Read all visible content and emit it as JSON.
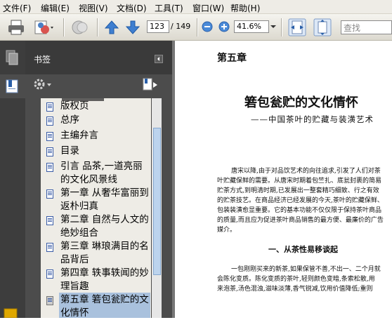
{
  "menu": [
    "文件(F)",
    "编辑(E)",
    "视图(V)",
    "文档(D)",
    "工具(T)",
    "窗口(W)",
    "帮助(H)"
  ],
  "toolbar": {
    "page_current": "123",
    "page_total": "/ 149",
    "zoom": "41.6%",
    "search_placeholder": "查找"
  },
  "panel": {
    "title": "书签"
  },
  "bookmarks": [
    {
      "label": "版权页"
    },
    {
      "label": "总序"
    },
    {
      "label": "主编弁言"
    },
    {
      "label": "目录"
    },
    {
      "label": "引言 品茶,一道亮丽的文化风景线"
    },
    {
      "label": "第一章 从奢华富丽到返朴归真"
    },
    {
      "label": "第二章 自然与人文的绝妙组合"
    },
    {
      "label": "第三章 琳琅满目的名品背后"
    },
    {
      "label": "第四章 轶事轶闻的妙理旨趣"
    },
    {
      "label": "第五章 箬包瓮贮的文化情怀",
      "selected": true
    }
  ],
  "document": {
    "chapter": "第五章",
    "title": "箬包瓮贮的文化情怀",
    "subtitle": "——中国茶叶的贮藏与装潢艺术",
    "para1": [
      "唐宋以降,由于对品饮艺术的向往追求,引发了人们对茶",
      "叶贮藏保鲜的需要。从唐宋时期着包竺扎、底瓮封裹的简易",
      "贮茶方式,到明清时期,已发展出一整套精巧细致、行之有效",
      "的贮茶技艺。在商品经济已经发展的今天,茶叶的贮藏保鲜、",
      "包装装潢愈显重要。它的基本功能不仅仅限于保持茶叶商品",
      "的质量,而且应为促进茶叶商品销售的最方便、最廉价的广告",
      "媒介。"
    ],
    "section": "一、从茶性易移谈起",
    "para2": [
      "一包刚刚买来的新茶,如果保管不善,不出一、二个月就",
      "会陈化变质。陈化变质的茶叶,轻则颜色变暗,条索松散,用",
      "来泡茶,汤色混浊,滋味淡薄,香气锐减,饮用价值降低;重则"
    ]
  }
}
